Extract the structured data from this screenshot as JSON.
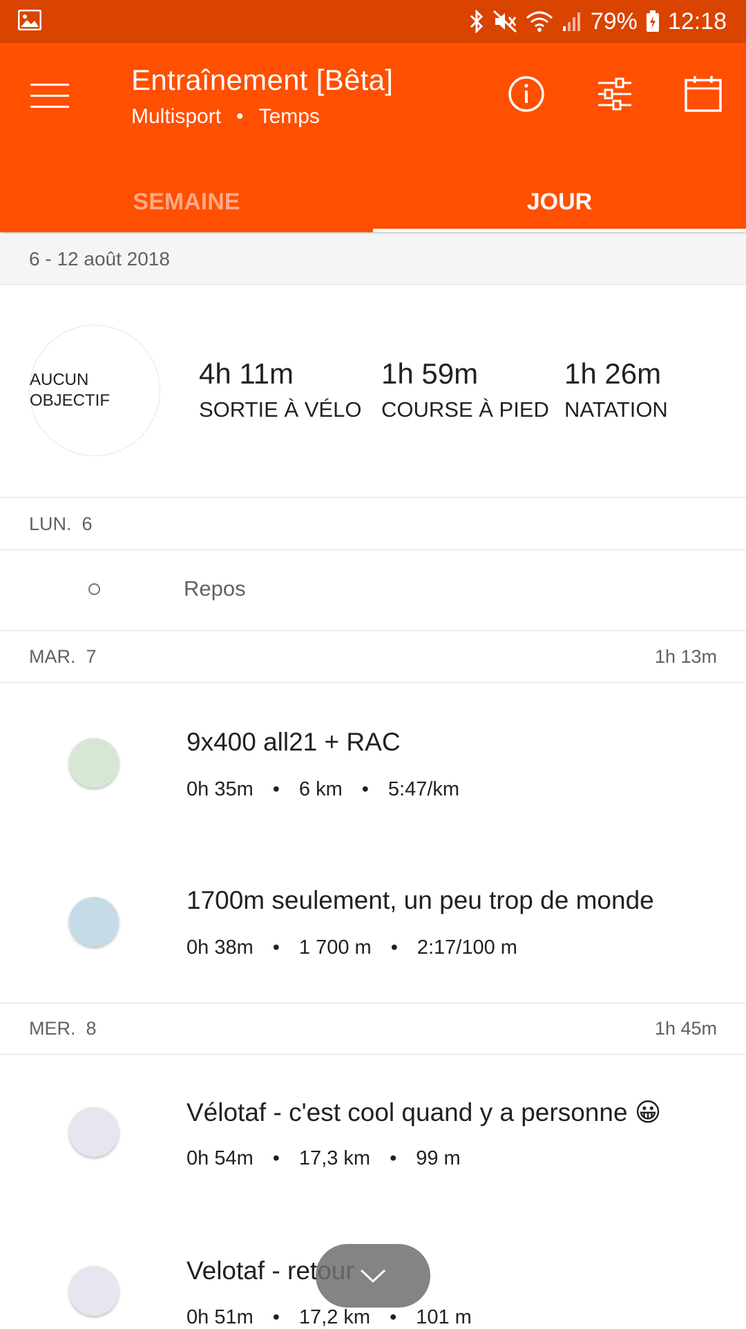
{
  "status_bar": {
    "battery": "79%",
    "time": "12:18",
    "icons": [
      "image-icon",
      "bluetooth-icon",
      "mute-icon",
      "wifi-icon",
      "signal-icon",
      "battery-icon"
    ]
  },
  "app_bar": {
    "title": "Entraînement [Bêta]",
    "subtitle_sport": "Multisport",
    "subtitle_dot": "•",
    "subtitle_metric": "Temps",
    "actions": [
      "info-icon",
      "filter-icon",
      "calendar-icon"
    ],
    "tabs": [
      {
        "label": "SEMAINE",
        "active": false
      },
      {
        "label": "JOUR",
        "active": true
      }
    ]
  },
  "week": {
    "range": "6 - 12 août 2018",
    "goal_line1": "AUCUN",
    "goal_line2": "OBJECTIF",
    "stats": [
      {
        "value": "4h 11m",
        "label": "SORTIE À VÉLO"
      },
      {
        "value": "1h 59m",
        "label": "COURSE À PIED"
      },
      {
        "value": "1h 26m",
        "label": "NATATION"
      }
    ]
  },
  "days": [
    {
      "label": "LUN.  6",
      "total": "",
      "rest": "Repos"
    },
    {
      "label": "MAR.  7",
      "total": "1h 13m"
    },
    {
      "label": "MER.  8",
      "total": "1h 45m"
    }
  ],
  "activities": [
    {
      "name": "9x400 all21 + RAC",
      "duration": "0h 35m",
      "distance": "6 km",
      "pace": "5:47/km",
      "color": "#d6e8d4",
      "sep": "•"
    },
    {
      "name": "1700m seulement, un peu trop de monde",
      "duration": "0h 38m",
      "distance": "1 700 m",
      "pace": "2:17/100 m",
      "color": "#c6dbe8",
      "sep": "•"
    },
    {
      "name": "Vélotaf - c'est cool quand y a personne 😀",
      "duration": "0h 54m",
      "distance": "17,3 km",
      "pace": "99 m",
      "color": "#e8e4f0",
      "sep": "•"
    },
    {
      "name": "Velotaf - retour",
      "duration": "0h 51m",
      "distance": "17,2 km",
      "pace": "101 m",
      "color": "#e8e4f0",
      "sep": "•"
    }
  ],
  "colors": {
    "status_bar": "#d94400",
    "app_bar": "#ff4f00",
    "tab_inactive": "#ffa985"
  }
}
